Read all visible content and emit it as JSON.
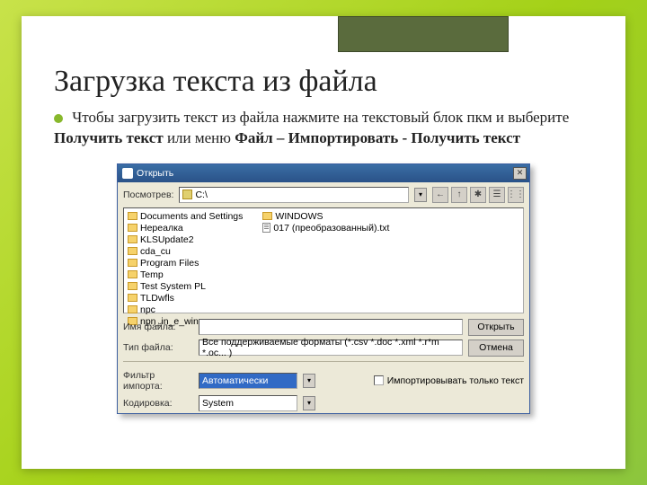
{
  "slide": {
    "title": "Загрузка текста из файла",
    "body_prefix": "Чтобы загрузить текст из файла нажмите на текстовый блок пкм и выберите ",
    "bold1": "Получить текст",
    "mid": " или меню ",
    "bold2": "Файл – Импортировать - Получить текст"
  },
  "dialog": {
    "title": "Открыть",
    "close": "✕",
    "lookin_label": "Посмотрев:",
    "lookin_value": "C:\\",
    "nav": {
      "back": "←",
      "up": "↑",
      "new": "✱",
      "list": "☰",
      "det": "⋮⋮"
    },
    "col1": [
      "Documents and Settings",
      "Нереалка",
      "KLSUpdate2",
      "cda_cu",
      "Program Files",
      "Temp",
      "Test System PL",
      "TLDwfls",
      "npc",
      "npn_in_e_wing"
    ],
    "col2_folder": "WINDOWS",
    "col2_file": "017 (преобразованный).txt",
    "rows": {
      "name_lbl": "Имя файла:",
      "name_val": "",
      "type_lbl": "Тип файла:",
      "type_val": "Все поддерживаемые форматы (*.csv *.doc *.xml *.r*m *.oc... )",
      "open": "Открыть",
      "cancel": "Отмена",
      "filter_lbl": "Фильтр импорта:",
      "filter_val": "Автоматически",
      "only_text": "Импортировывать только текст",
      "enc_lbl": "Кодировка:",
      "enc_val": "System"
    }
  }
}
